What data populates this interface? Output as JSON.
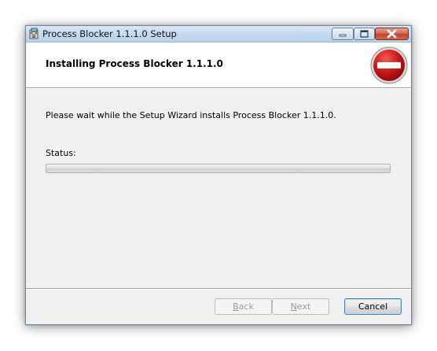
{
  "window": {
    "title": "Process Blocker 1.1.1.0 Setup"
  },
  "header": {
    "title": "Installing Process Blocker 1.1.1.0"
  },
  "body": {
    "message": "Please wait while the Setup Wizard installs Process Blocker 1.1.1.0.",
    "status_label": "Status:",
    "progress_fraction": 0
  },
  "buttons": {
    "back": {
      "mnemonic": "B",
      "rest": "ack",
      "enabled": false
    },
    "next": {
      "mnemonic": "N",
      "rest": "ext",
      "enabled": false
    },
    "cancel": {
      "label": "Cancel",
      "enabled": true
    }
  },
  "icons": {
    "app": "installer-package-icon",
    "logo": "no-entry-icon",
    "minimize": "minimize-icon",
    "maximize": "maximize-icon",
    "close": "close-icon"
  },
  "colors": {
    "logo_red": "#c9171b",
    "titlebar": "#c7dcf0",
    "close_button": "#c1432b",
    "default_button_border": "#3c7fb1"
  }
}
